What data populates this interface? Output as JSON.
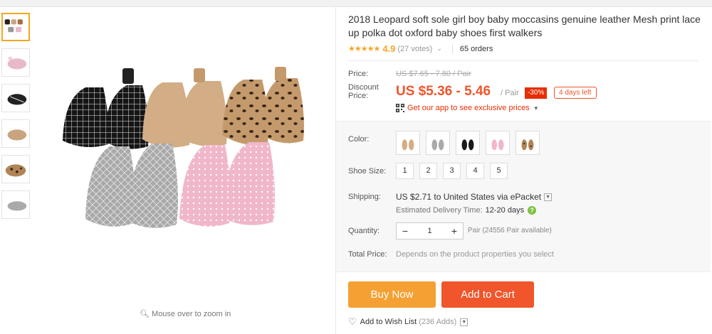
{
  "product": {
    "title": "2018 Leopard soft sole girl boy baby moccasins genuine leather Mesh print lace up polka dot oxford baby shoes first walkers",
    "rating": {
      "stars": "★★★★★",
      "score": "4.9",
      "votes": "(27 votes)",
      "orders": "65 orders"
    }
  },
  "gallery": {
    "thumbnails": [
      "all-colors",
      "pink",
      "black",
      "tan",
      "leopard",
      "gray"
    ],
    "active_index": 0,
    "zoom_hint": "Mouse over to zoom in"
  },
  "pricing": {
    "price_label": "Price:",
    "original_price": "US $7.65 - 7.80 / Pair",
    "discount_label_1": "Discount",
    "discount_label_2": "Price:",
    "discount_price": "US $5.36 - 5.46",
    "unit": "/ Pair",
    "discount_badge": "-30%",
    "days_left": "4 days left",
    "app_link": "Get our app to see exclusive prices"
  },
  "options": {
    "color_label": "Color:",
    "colors": [
      "tan",
      "gray",
      "black",
      "pink",
      "leopard"
    ],
    "size_label": "Shoe Size:",
    "sizes": [
      "1",
      "2",
      "3",
      "4",
      "5"
    ],
    "shipping_label": "Shipping:",
    "shipping_text": "US $2.71 to United States via ePacket",
    "delivery_label": "Estimated Delivery Time:",
    "delivery_days": "12-20 days",
    "quantity_label": "Quantity:",
    "quantity_value": "1",
    "quantity_available": "Pair (24556 Pair available)",
    "total_label": "Total Price:",
    "total_text": "Depends on the product properties you select"
  },
  "actions": {
    "buy_now": "Buy Now",
    "add_to_cart": "Add to Cart",
    "wish_list": "Add to Wish List",
    "wish_count": "(236 Adds)"
  },
  "colors": {
    "accent": "#f0552b",
    "buy": "#f5a032",
    "star": "#f5a623"
  }
}
